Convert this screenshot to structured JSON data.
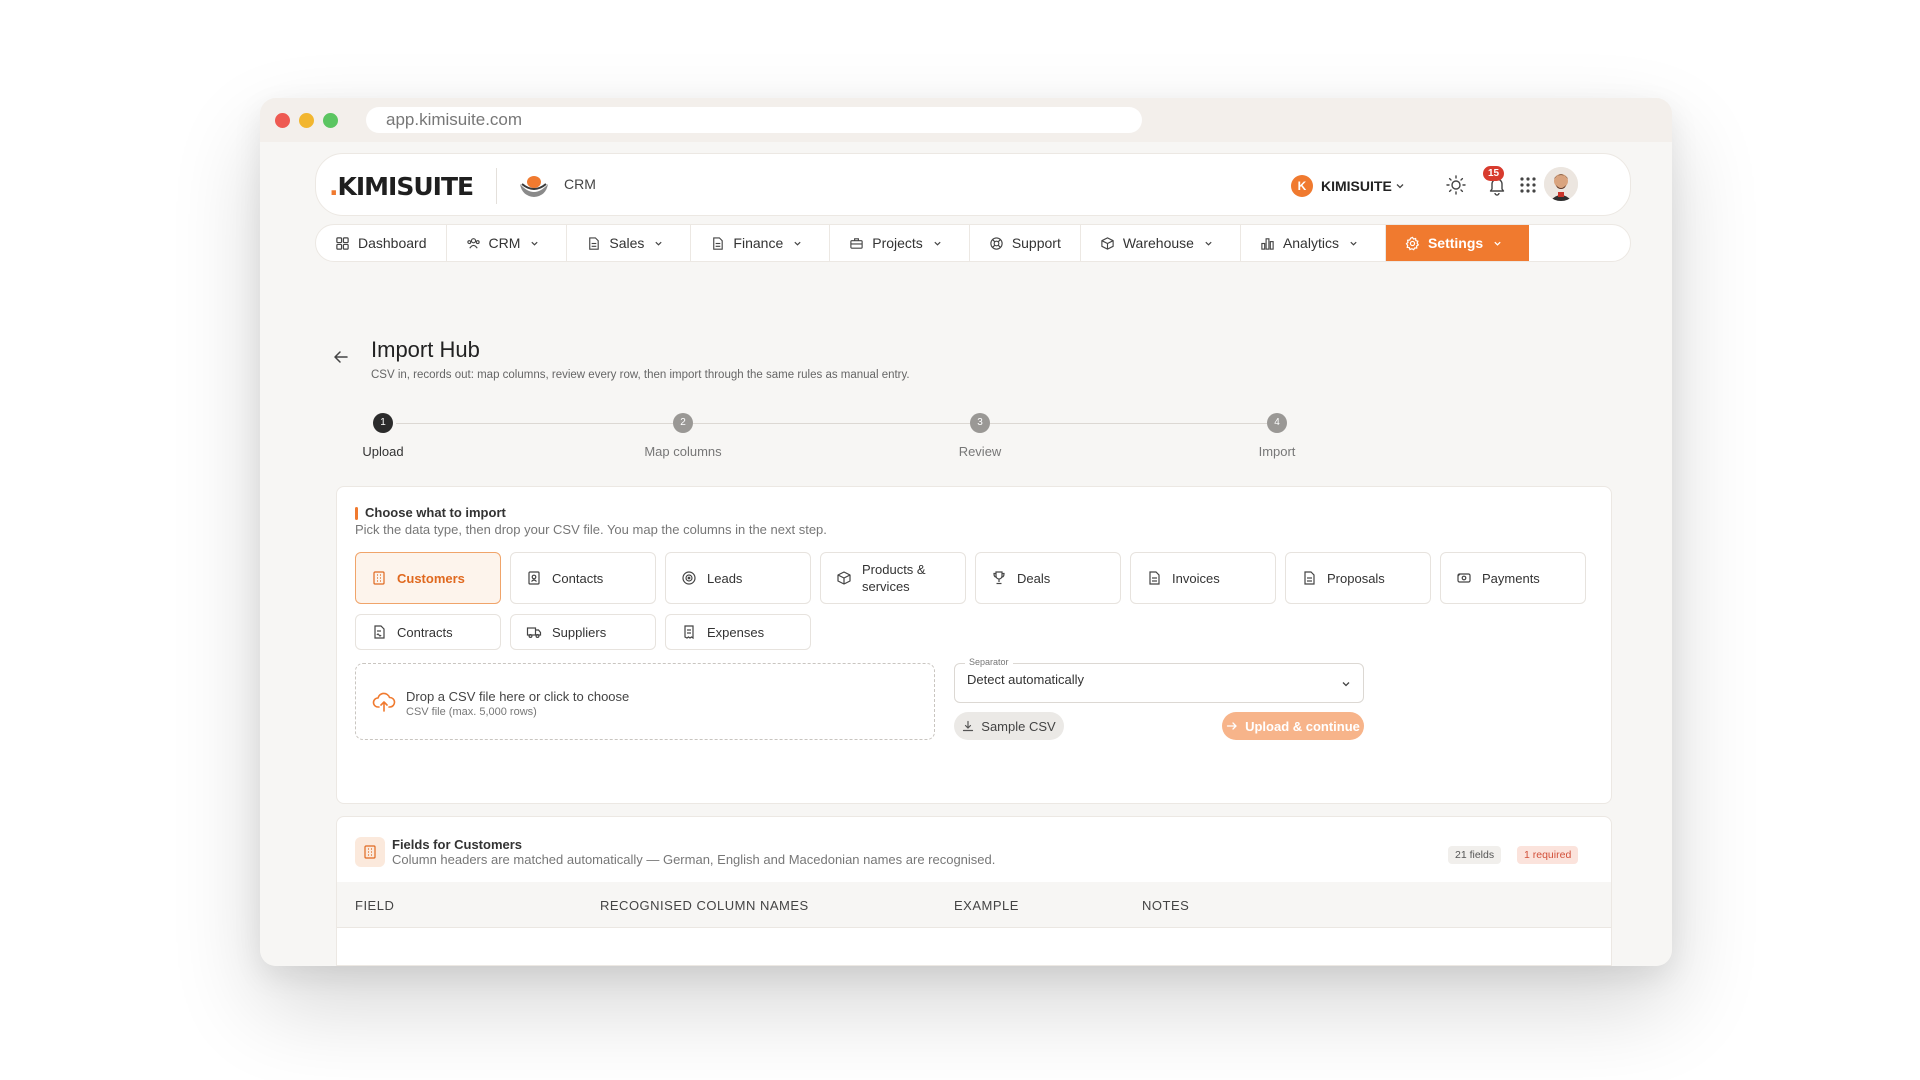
{
  "browser": {
    "url": "app.kimisuite.com"
  },
  "header": {
    "logo": "KIMISUITE",
    "app_label": "CRM",
    "org_initial": "K",
    "org_name": "KIMISUITE",
    "notifications": "15"
  },
  "nav": {
    "items": [
      {
        "label": "Dashboard",
        "icon": "dashboard-icon",
        "dropdown": false
      },
      {
        "label": "CRM",
        "icon": "users-icon",
        "dropdown": true
      },
      {
        "label": "Sales",
        "icon": "document-icon",
        "dropdown": true
      },
      {
        "label": "Finance",
        "icon": "document-icon",
        "dropdown": true
      },
      {
        "label": "Projects",
        "icon": "briefcase-icon",
        "dropdown": true
      },
      {
        "label": "Support",
        "icon": "lifebuoy-icon",
        "dropdown": false
      },
      {
        "label": "Warehouse",
        "icon": "box-icon",
        "dropdown": true
      },
      {
        "label": "Analytics",
        "icon": "bar-chart-icon",
        "dropdown": true
      },
      {
        "label": "Settings",
        "icon": "gear-icon",
        "dropdown": true,
        "active": true
      }
    ]
  },
  "page": {
    "title": "Import Hub",
    "subtitle": "CSV in, records out: map columns, review every row, then import through the same rules as manual entry."
  },
  "steps": [
    {
      "number": "1",
      "label": "Upload",
      "current": true
    },
    {
      "number": "2",
      "label": "Map columns"
    },
    {
      "number": "3",
      "label": "Review"
    },
    {
      "number": "4",
      "label": "Import"
    }
  ],
  "choose": {
    "title": "Choose what to import",
    "description": "Pick the data type, then drop your CSV file. You map the columns in the next step.",
    "types": [
      "Customers",
      "Contacts",
      "Leads",
      "Products & services",
      "Deals",
      "Invoices",
      "Proposals",
      "Payments",
      "Contracts",
      "Suppliers",
      "Expenses"
    ],
    "selected": "Customers"
  },
  "dropzone": {
    "title": "Drop a CSV file here or click to choose",
    "subtitle": "CSV file (max. 5,000 rows)"
  },
  "separator": {
    "legend": "Separator",
    "value": "Detect automatically"
  },
  "buttons": {
    "sample": "Sample CSV",
    "upload": "Upload & continue"
  },
  "fields": {
    "title": "Fields for Customers",
    "description": "Column headers are matched automatically — German, English and Macedonian names are recognised.",
    "count_badge": "21 fields",
    "required_badge": "1 required",
    "columns": [
      "FIELD",
      "RECOGNISED COLUMN NAMES",
      "EXAMPLE",
      "NOTES"
    ]
  },
  "colors": {
    "accent": "#f07a2f",
    "accent_soft": "#f7b48a"
  }
}
